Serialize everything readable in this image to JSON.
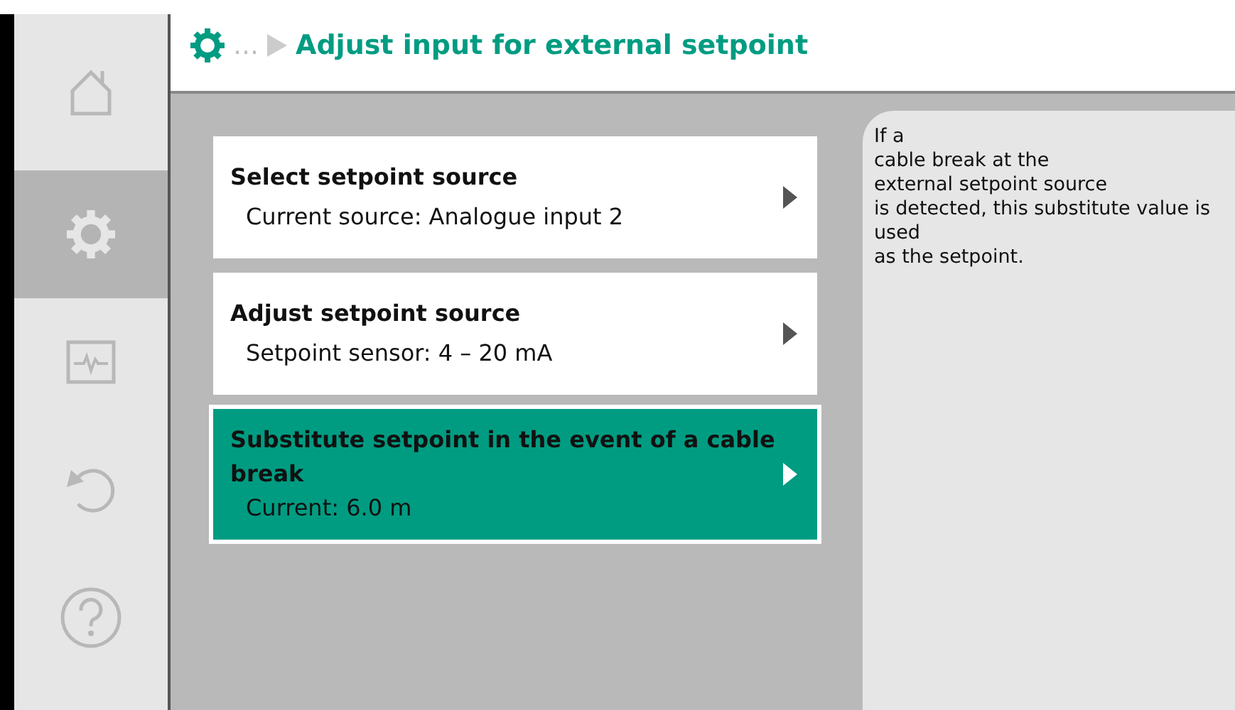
{
  "sidebar": {
    "items": [
      {
        "kind": "home",
        "selected": false
      },
      {
        "kind": "settings",
        "selected": true
      },
      {
        "kind": "diagnostics",
        "selected": false
      },
      {
        "kind": "undo",
        "selected": false
      },
      {
        "kind": "help",
        "selected": false
      }
    ]
  },
  "header": {
    "ellipsis": "…",
    "title": "Adjust input for external setpoint"
  },
  "menu_items": [
    {
      "title": "Select setpoint source",
      "subtitle": "Current source: Analogue input 2",
      "selected": false
    },
    {
      "title": "Adjust setpoint source",
      "subtitle": "Setpoint sensor: 4 – 20 mA",
      "selected": false
    },
    {
      "title": "Substitute setpoint in the event of a cable break",
      "subtitle": "Current: 6.0 m",
      "selected": true
    }
  ],
  "help_text": "If a\ncable break at the\nexternal setpoint source\nis detected, this substitute value is\nused\nas the setpoint."
}
